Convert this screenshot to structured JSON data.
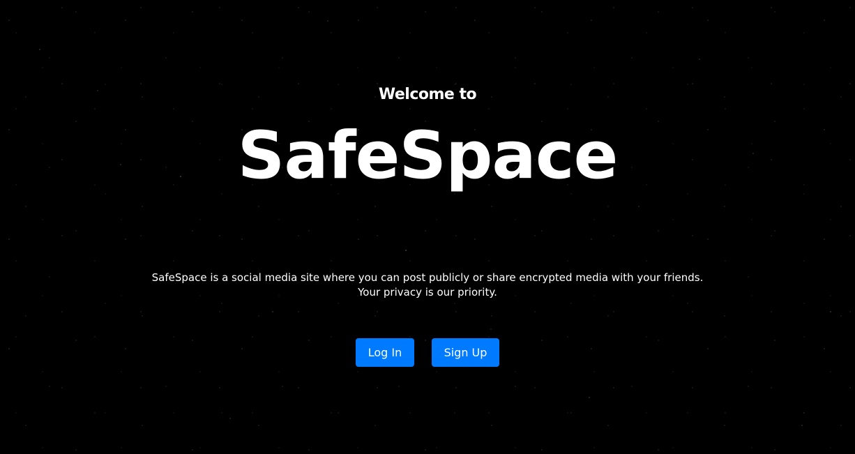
{
  "hero": {
    "welcome": "Welcome to",
    "brand": "SafeSpace",
    "description_line1": "SafeSpace is a social media site where you can post publicly or share encrypted media with your friends.",
    "description_line2": "Your privacy is our priority."
  },
  "actions": {
    "login_label": "Log In",
    "signup_label": "Sign Up"
  },
  "colors": {
    "background": "#000000",
    "text": "#ffffff",
    "button": "#007bff"
  }
}
